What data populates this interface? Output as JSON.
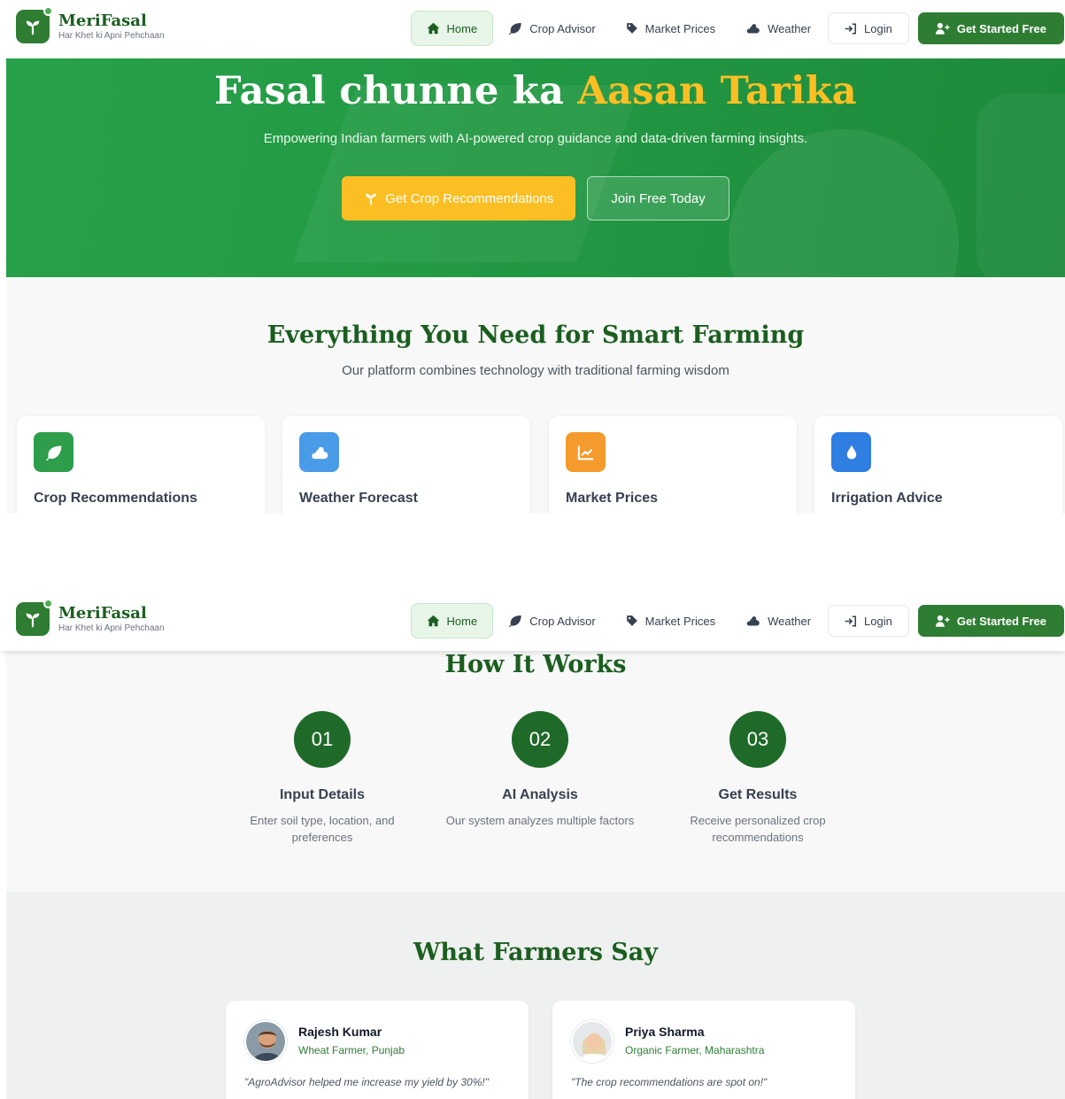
{
  "brand": {
    "name_part1": "Meri",
    "name_part2": "Fasal",
    "tagline": "Har Khet ki Apni Pehchaan"
  },
  "nav": {
    "items": [
      {
        "label": "Home",
        "icon": "home-icon",
        "active": true
      },
      {
        "label": "Crop Advisor",
        "icon": "leaf-icon"
      },
      {
        "label": "Market Prices",
        "icon": "tag-icon"
      },
      {
        "label": "Weather",
        "icon": "cloud-sun-icon"
      }
    ],
    "login_label": "Login",
    "cta_label": "Get Started Free"
  },
  "hero": {
    "title_main": "Fasal chunne ka ",
    "title_highlight": "Aasan Tarika",
    "subtitle": "Empowering Indian farmers with AI-powered crop guidance and data-driven farming insights.",
    "primary_cta": "Get Crop Recommendations",
    "secondary_cta": "Join Free Today"
  },
  "features": {
    "title": "Everything You Need for Smart Farming",
    "subtitle": "Our platform combines technology with traditional farming wisdom",
    "cards": [
      {
        "label": "Crop Recommendations",
        "icon": "leaf-icon",
        "color": "#2e9e4a"
      },
      {
        "label": "Weather Forecast",
        "icon": "cloud-sun-icon",
        "color": "#4a9be8"
      },
      {
        "label": "Market Prices",
        "icon": "chart-line-icon",
        "color": "#f59a2c"
      },
      {
        "label": "Irrigation Advice",
        "icon": "droplet-icon",
        "color": "#2f7fe3"
      }
    ]
  },
  "how": {
    "title": "How It Works",
    "steps": [
      {
        "number": "01",
        "title": "Input Details",
        "desc": "Enter soil type, location, and preferences"
      },
      {
        "number": "02",
        "title": "AI Analysis",
        "desc": "Our system analyzes multiple factors"
      },
      {
        "number": "03",
        "title": "Get Results",
        "desc": "Receive personalized crop recommendations"
      }
    ]
  },
  "testimonials": {
    "title": "What Farmers Say",
    "items": [
      {
        "name": "Rajesh Kumar",
        "role": "Wheat Farmer, Punjab",
        "quote": "\"AgroAdvisor helped me increase my yield by 30%!\""
      },
      {
        "name": "Priya Sharma",
        "role": "Organic Farmer, Maharashtra",
        "quote": "\"The crop recommendations are spot on!\""
      }
    ]
  },
  "colors": {
    "primary": "#2e7d32",
    "accent": "#fbbf24",
    "heading": "#1b5e20"
  }
}
